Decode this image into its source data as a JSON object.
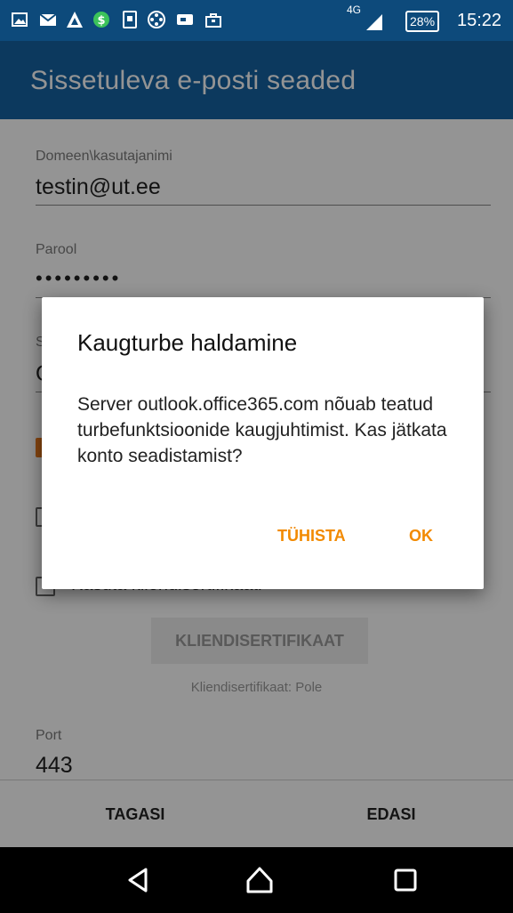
{
  "status_bar": {
    "network": "4G",
    "battery": "28%",
    "time": "15:22"
  },
  "app_bar": {
    "title": "Sissetuleva e-posti seaded"
  },
  "form": {
    "username_label": "Domeen\\kasutajanimi",
    "username_value": "testin@ut.ee",
    "password_label": "Parool",
    "password_value": "•••••••••",
    "server_label_fragment": "S",
    "server_value_fragment": "O",
    "client_cert_checkbox_label": "Kasuta kliendisertifikaati",
    "client_cert_button": "KLIENDISERTIFIKAAT",
    "client_cert_status": "Kliendisertifikaat: Pole",
    "port_label": "Port",
    "port_value": "443"
  },
  "actions": {
    "back": "TAGASI",
    "next": "EDASI"
  },
  "dialog": {
    "title": "Kaugturbe haldamine",
    "message": "Server outlook.office365.com nõuab teatud turbefunktsioonide kaugjuhtimist. Kas jätkata konto seadistamist?",
    "cancel": "TÜHISTA",
    "ok": "OK"
  },
  "colors": {
    "status_bar": "#0d4a7b",
    "app_bar": "#1563a3",
    "accent": "#f28a00"
  },
  "icons": {
    "status_left": [
      "picture-icon",
      "mail-icon",
      "alert-app-icon",
      "money-app-icon",
      "file-app-icon",
      "film-icon",
      "chat-icon",
      "briefcase-icon"
    ],
    "status_right": [
      "signal-icon",
      "battery-icon"
    ],
    "nav": [
      "back-icon",
      "home-icon",
      "recents-icon"
    ]
  }
}
